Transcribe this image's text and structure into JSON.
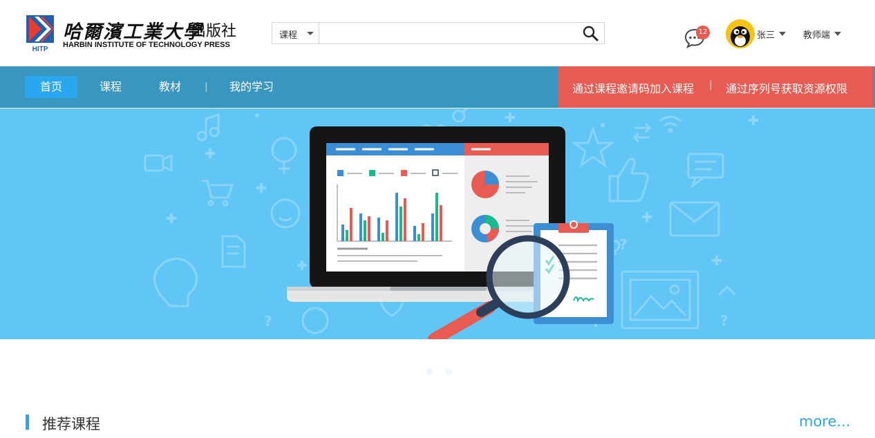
{
  "header": {
    "logo": {
      "name_cn": "哈爾濱工業大學",
      "press_cn": "出版社",
      "name_en": "HARBIN INSTITUTE OF TECHNOLOGY PRESS",
      "abbr": "HITP"
    },
    "search": {
      "category": "课程",
      "value": "",
      "placeholder": ""
    },
    "messages": {
      "count": "12"
    },
    "user": {
      "name": "张三"
    },
    "role": "教师端"
  },
  "nav": {
    "items": [
      {
        "label": "首页",
        "active": true
      },
      {
        "label": "课程"
      },
      {
        "label": "教材"
      },
      {
        "label": "我的学习"
      }
    ],
    "right_links": [
      {
        "label": "通过课程邀请码加入课程"
      },
      {
        "label": "通过序列号获取资源权限"
      }
    ]
  },
  "banner": {
    "slides": 2,
    "active_slide": 1
  },
  "section": {
    "title": "推荐课程",
    "more": "more..."
  },
  "colors": {
    "nav_bg": "#3896bf",
    "nav_active": "#2aa7ef",
    "nav_right_bg": "#e85b52",
    "banner_bg": "#61c6f5",
    "accent": "#2aa7ef",
    "badge": "#e85a50"
  }
}
